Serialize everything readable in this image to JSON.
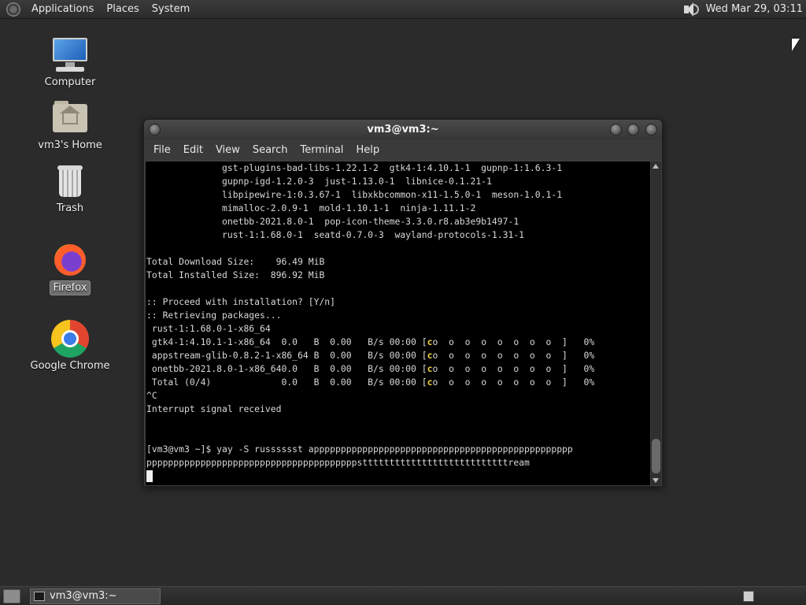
{
  "top_panel": {
    "menus": [
      "Applications",
      "Places",
      "System"
    ],
    "clock": "Wed Mar 29, 03:11"
  },
  "desktop": {
    "icons": [
      {
        "label": "Computer",
        "icon": "computer-icon"
      },
      {
        "label": "vm3's Home",
        "icon": "home-folder-icon"
      },
      {
        "label": "Trash",
        "icon": "trash-icon"
      },
      {
        "label": "Firefox",
        "icon": "firefox-icon"
      },
      {
        "label": "Google Chrome",
        "icon": "chrome-icon"
      }
    ]
  },
  "terminal": {
    "title": "vm3@vm3:~",
    "menu": [
      "File",
      "Edit",
      "View",
      "Search",
      "Terminal",
      "Help"
    ],
    "lines": [
      "              gst-plugins-bad-libs-1.22.1-2  gtk4-1:4.10.1-1  gupnp-1:1.6.3-1",
      "              gupnp-igd-1.2.0-3  just-1.13.0-1  libnice-0.1.21-1",
      "              libpipewire-1:0.3.67-1  libxkbcommon-x11-1.5.0-1  meson-1.0.1-1",
      "              mimalloc-2.0.9-1  mold-1.10.1-1  ninja-1.11.1-2",
      "              onetbb-2021.8.0-1  pop-icon-theme-3.3.0.r8.ab3e9b1497-1",
      "              rust-1:1.68.0-1  seatd-0.7.0-3  wayland-protocols-1.31-1",
      "",
      "Total Download Size:    96.49 MiB",
      "Total Installed Size:  896.92 MiB",
      "",
      ":: Proceed with installation? [Y/n]",
      ":: Retrieving packages...",
      " rust-1:1.68.0-1-x86_64"
    ],
    "progress_rows": [
      {
        "name": " gtk4-1:4.10.1-1-x86_64  0.0   B  0.00   B/s 00:00 ",
        "bar": "[",
        "pac": "c",
        "dots": "o  o  o  o  o  o  o  o  ]",
        "pct": "0%"
      },
      {
        "name": " appstream-glib-0.8.2-1-x86_64 B  0.00   B/s 00:00 ",
        "bar": "[",
        "pac": "c",
        "dots": "o  o  o  o  o  o  o  o  ]",
        "pct": "0%"
      },
      {
        "name": " onetbb-2021.8.0-1-x86_640.0   B  0.00   B/s 00:00 ",
        "bar": "[",
        "pac": "c",
        "dots": "o  o  o  o  o  o  o  o  ]",
        "pct": "0%"
      },
      {
        "name": " Total (0/4)             0.0   B  0.00   B/s 00:00 ",
        "bar": "[",
        "pac": "c",
        "dots": "o  o  o  o  o  o  o  o  ]",
        "pct": "0%"
      }
    ],
    "after_lines": [
      "^C",
      "Interrupt signal received",
      "",
      "",
      "[vm3@vm3 ~]$ yay -S russsssst apppppppppppppppppppppppppppppppppppppppppppppppp",
      "pppppppppppppppppppppppppppppppppppppppstttttttttttttttttttttttttttream"
    ]
  },
  "taskbar": {
    "task_label": "vm3@vm3:~"
  },
  "colors": {
    "desktop_bg": "#2b2b2b",
    "terminal_bg": "#000000",
    "terminal_fg": "#d8d8d8",
    "pacman_yellow": "#f2d23a"
  }
}
